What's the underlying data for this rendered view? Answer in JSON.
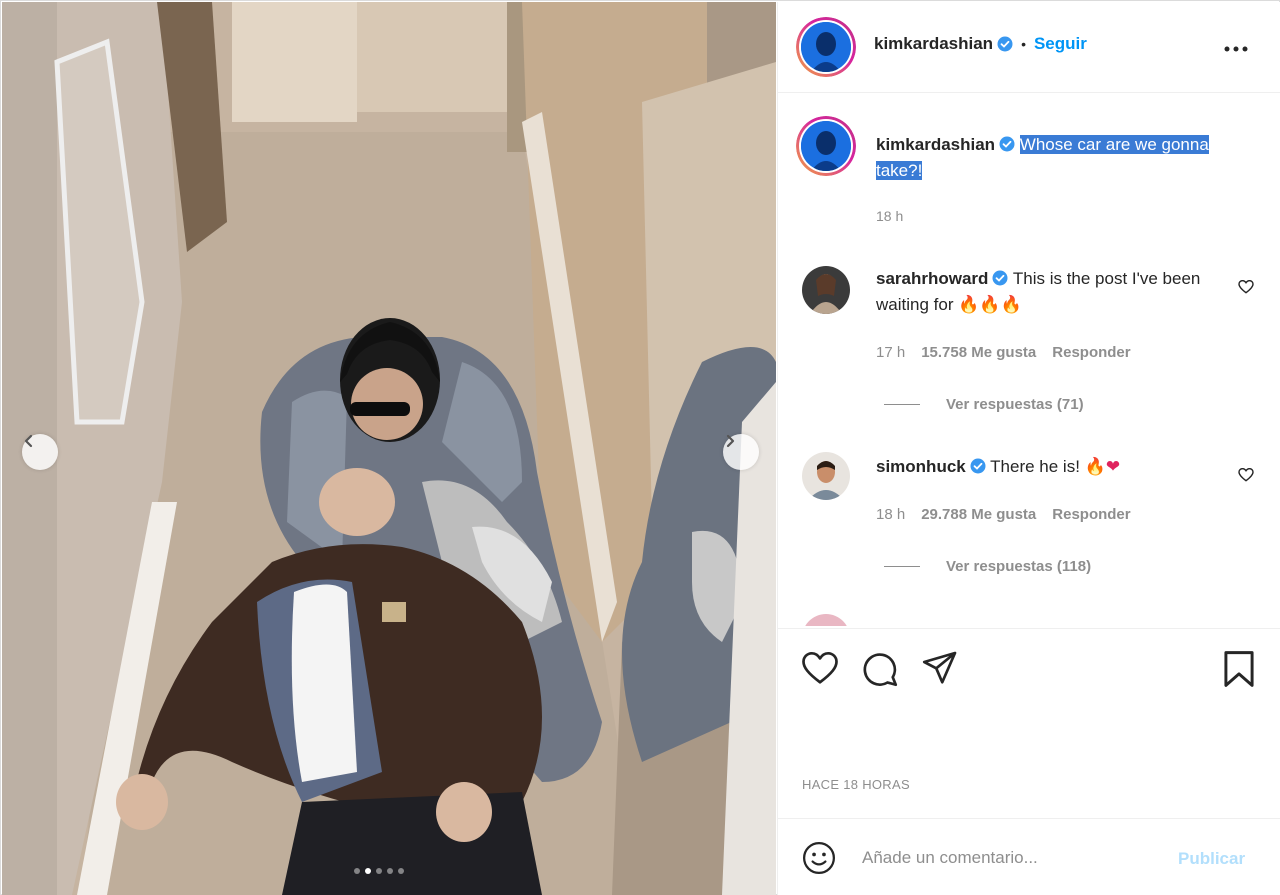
{
  "post": {
    "author": "kimkardashian",
    "follow_label": "Seguir",
    "separator": "•",
    "caption": "Whose car are we gonna take?!",
    "caption_time": "18 h",
    "date_label": "HACE 18 HORAS"
  },
  "carousel": {
    "slides": 5,
    "active": 2
  },
  "comments": [
    {
      "username": "sarahrhoward",
      "text": "This is the post I've been waiting for",
      "emoji": "🔥🔥🔥",
      "time": "17 h",
      "likes": "15.758 Me gusta",
      "reply_label": "Responder",
      "view_replies": "Ver respuestas (71)"
    },
    {
      "username": "simonhuck",
      "text": "There he is!",
      "emoji": "🔥❤",
      "time": "18 h",
      "likes": "29.788 Me gusta",
      "reply_label": "Responder",
      "view_replies": "Ver respuestas (118)"
    }
  ],
  "add_comment": {
    "placeholder": "Añade un comentario...",
    "publish_label": "Publicar"
  },
  "icons": {
    "like": "heart-icon",
    "comment": "comment-icon",
    "share": "share-icon",
    "save": "bookmark-icon",
    "emoji": "smiley-icon",
    "more": "more-options-icon",
    "verified": "verified-badge-icon"
  },
  "colors": {
    "link_blue": "#0095f6",
    "verified_blue": "#3897f0",
    "muted": "#8e8e8e",
    "highlight": "#3a7bd5"
  }
}
